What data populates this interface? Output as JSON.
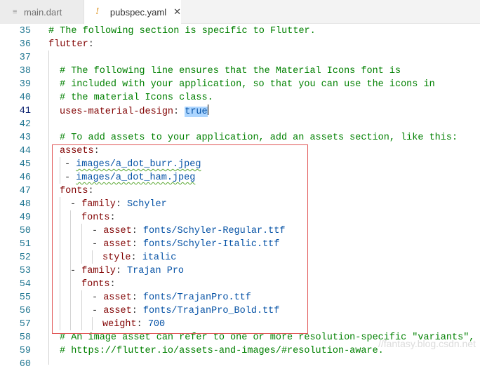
{
  "tabs": [
    {
      "label": "main.dart",
      "icon": "lines-icon",
      "active": false
    },
    {
      "label": "pubspec.yaml",
      "icon": "exclamation-icon",
      "active": true,
      "close": "✕"
    }
  ],
  "colors": {
    "comment": "#008000",
    "key": "#800000",
    "value": "#0451a5",
    "line_number": "#237893",
    "highlight_box": "#e05555"
  },
  "watermark": "//fantasy.blog.csdn.net",
  "lines": [
    {
      "n": "35",
      "c": "# The following section is specific to Flutter."
    },
    {
      "n": "36",
      "k": "flutter",
      "p": ":"
    },
    {
      "n": "37"
    },
    {
      "n": "38",
      "c": "# The following line ensures that the Material Icons font is"
    },
    {
      "n": "39",
      "c": "# included with your application, so that you can use the icons in"
    },
    {
      "n": "40",
      "c": "# the material Icons class."
    },
    {
      "n": "41",
      "k": "uses-material-design",
      "p": ": ",
      "v": "true"
    },
    {
      "n": "42"
    },
    {
      "n": "43",
      "c": "# To add assets to your application, add an assets section, like this:"
    },
    {
      "n": "44",
      "k": "assets",
      "p": ":"
    },
    {
      "n": "45",
      "p": "- ",
      "v": "images/a_dot_burr.jpeg"
    },
    {
      "n": "46",
      "p": "- ",
      "v": "images/a_dot_ham.jpeg"
    },
    {
      "n": "47",
      "k": "fonts",
      "p": ":"
    },
    {
      "n": "48",
      "p": "- ",
      "k": "family",
      "p2": ": ",
      "v": "Schyler"
    },
    {
      "n": "49",
      "k": "fonts",
      "p": ":"
    },
    {
      "n": "50",
      "p": "- ",
      "k": "asset",
      "p2": ": ",
      "v": "fonts/Schyler-Regular.ttf"
    },
    {
      "n": "51",
      "p": "- ",
      "k": "asset",
      "p2": ": ",
      "v": "fonts/Schyler-Italic.ttf"
    },
    {
      "n": "52",
      "k": "style",
      "p": ": ",
      "v": "italic"
    },
    {
      "n": "53",
      "p": "- ",
      "k": "family",
      "p2": ": ",
      "v": "Trajan Pro"
    },
    {
      "n": "54",
      "k": "fonts",
      "p": ":"
    },
    {
      "n": "55",
      "p": "- ",
      "k": "asset",
      "p2": ": ",
      "v": "fonts/TrajanPro.ttf"
    },
    {
      "n": "56",
      "p": "- ",
      "k": "asset",
      "p2": ": ",
      "v": "fonts/TrajanPro_Bold.ttf"
    },
    {
      "n": "57",
      "k": "weight",
      "p": ": ",
      "v": "700"
    },
    {
      "n": "58",
      "c": "# An image asset can refer to one or more resolution-specific \"variants\", see"
    },
    {
      "n": "59",
      "c": "# https://flutter.io/assets-and-images/#resolution-aware."
    },
    {
      "n": "60"
    }
  ]
}
